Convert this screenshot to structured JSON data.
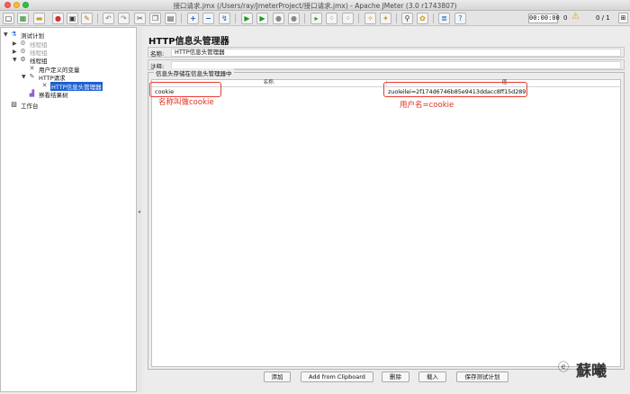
{
  "window": {
    "title": "接口请求.jmx (/Users/ray/JmeterProject/接口请求.jmx) - Apache JMeter (3.0 r1743807)"
  },
  "toolbar": {
    "timer": "00:00:00",
    "error_count": "0",
    "threads": "0 / 1"
  },
  "tree": {
    "nodes": [
      {
        "label": "测试计划",
        "icon": "test-plan-icon",
        "arrow": "▼"
      },
      {
        "label": "线程组",
        "icon": "thread-group-icon",
        "arrow": "▶"
      },
      {
        "label": "线程组",
        "icon": "thread-group-icon",
        "arrow": "▶"
      },
      {
        "label": "线程组",
        "icon": "thread-group-icon",
        "arrow": "▼"
      },
      {
        "label": "用户定义的变量",
        "icon": "wrench-icon",
        "arrow": ""
      },
      {
        "label": "HTTP请求",
        "icon": "pencil-icon",
        "arrow": "▼"
      },
      {
        "label": "HTTP信息头管理器",
        "icon": "wrench-icon",
        "arrow": ""
      },
      {
        "label": "察看结果树",
        "icon": "chart-icon",
        "arrow": ""
      },
      {
        "label": "工作台",
        "icon": "workbench-icon",
        "arrow": ""
      }
    ]
  },
  "panel": {
    "heading": "HTTP信息头管理器",
    "name_label": "名称:",
    "name_value": "HTTP信息头管理器",
    "comment_label": "注释:",
    "comment_value": "",
    "group_title": "信息头存储在信息头管理器中",
    "columns": {
      "name": "名称:",
      "value": "值"
    },
    "rows": [
      {
        "name": "cookie",
        "value": "zuoleilei=2f174d6746b85e9413ddacc8ff15d289"
      }
    ]
  },
  "annotations": {
    "name_note": "名称叫做cookie",
    "value_note": "用户名=cookie"
  },
  "buttons": {
    "add": "添加",
    "add_clipboard": "Add from Clipboard",
    "delete": "删除",
    "load": "载入",
    "save_plan": "保存测试计划"
  },
  "watermark": {
    "text": "蘇曦"
  }
}
